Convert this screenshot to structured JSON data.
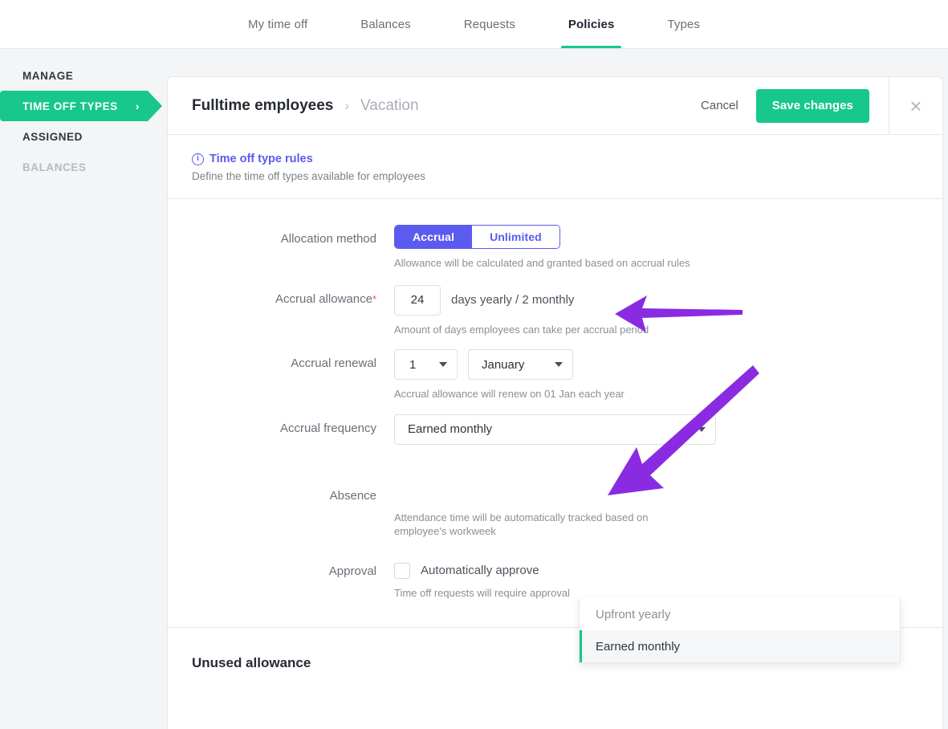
{
  "colors": {
    "accent_green": "#18c78c",
    "accent_purple": "#5b5bf0",
    "annotation_purple": "#8a2be2",
    "required_red": "#f0533f"
  },
  "topnav": {
    "tabs": [
      {
        "label": "My time off",
        "active": false
      },
      {
        "label": "Balances",
        "active": false
      },
      {
        "label": "Requests",
        "active": false
      },
      {
        "label": "Policies",
        "active": true
      },
      {
        "label": "Types",
        "active": false
      }
    ]
  },
  "sidebar": {
    "items": [
      {
        "label": "MANAGE",
        "state": "normal"
      },
      {
        "label": "TIME OFF TYPES",
        "state": "active",
        "chevron": "chevron-right-icon"
      },
      {
        "label": "ASSIGNED",
        "state": "normal"
      },
      {
        "label": "BALANCES",
        "state": "muted"
      }
    ]
  },
  "header": {
    "breadcrumb_main": "Fulltime employees",
    "breadcrumb_separator": "›",
    "breadcrumb_sub": "Vacation",
    "cancel_label": "Cancel",
    "save_label": "Save changes",
    "close_label": "×"
  },
  "info": {
    "icon": "info-circle-icon",
    "icon_glyph": "i",
    "title": "Time off type rules",
    "subtitle": "Define the time off types available for employees"
  },
  "form": {
    "allocation_method": {
      "label": "Allocation method",
      "options": [
        {
          "label": "Accrual",
          "selected": true
        },
        {
          "label": "Unlimited",
          "selected": false
        }
      ],
      "hint": "Allowance will be calculated and granted based on accrual rules"
    },
    "accrual_allowance": {
      "label": "Accrual allowance",
      "required_marker": "*",
      "value": "24",
      "unit": "days yearly / 2 monthly",
      "hint": "Amount of days employees can take per accrual period"
    },
    "accrual_renewal": {
      "label": "Accrual renewal",
      "day_value": "1",
      "month_value": "January",
      "hint": "Accrual allowance will renew on 01 Jan each year"
    },
    "accrual_frequency": {
      "label": "Accrual frequency",
      "value": "Earned monthly",
      "open": true,
      "options": [
        {
          "label": "Upfront yearly",
          "selected": false
        },
        {
          "label": "Earned monthly",
          "selected": true
        }
      ]
    },
    "absence": {
      "label": "Absence",
      "hint": "Attendance time will be automatically tracked based on employee's workweek"
    },
    "approval": {
      "label": "Approval",
      "checkbox_label": "Automatically approve",
      "checked": false,
      "hint": "Time off requests will require approval"
    }
  },
  "section": {
    "unused_allowance_title": "Unused allowance"
  },
  "annotations": [
    {
      "name": "arrow-to-accrual-unit",
      "direction": "left",
      "from": [
        925,
        388
      ],
      "to": [
        766,
        390
      ]
    },
    {
      "name": "arrow-to-dropdown-option",
      "direction": "down-left",
      "from": [
        938,
        455
      ],
      "to": [
        757,
        617
      ]
    }
  ]
}
